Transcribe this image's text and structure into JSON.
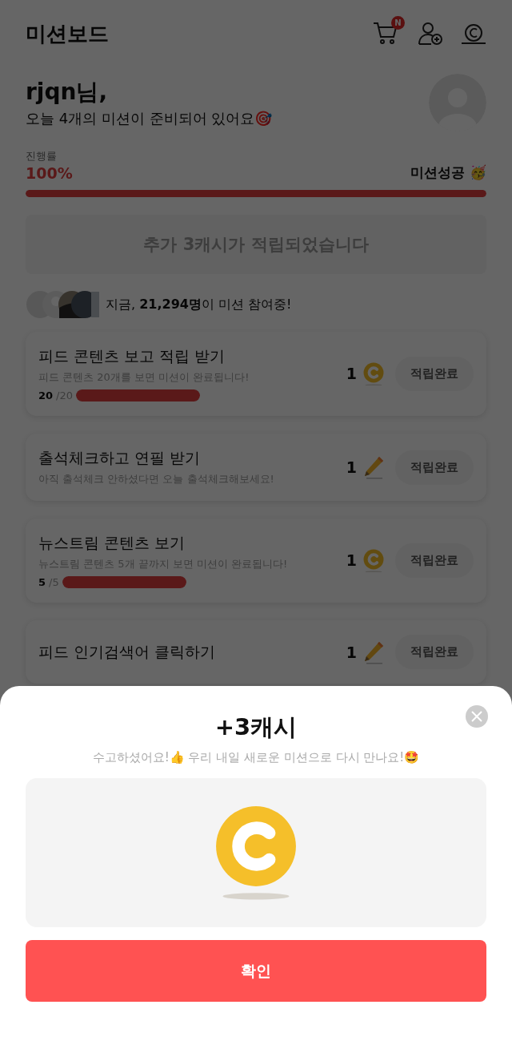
{
  "header": {
    "title": "미션보드",
    "cart_badge": "N"
  },
  "greeting": {
    "name": "rjqn님,",
    "message": "오늘 4개의 미션이 준비되어 있어요🎯"
  },
  "progress": {
    "label": "진행률",
    "percent": "100%",
    "status": "미션성공 🥳",
    "level": 1
  },
  "banner": {
    "text": "추가 3캐시가 적립되었습니다"
  },
  "participants": {
    "text": "지금, **21,294명**이 미션 참여중!"
  },
  "missions": [
    {
      "title": "피드 콘텐츠 보고 적립 받기",
      "description": "피드 콘텐츠 20개를 보면 미션이 완료됩니다!",
      "done": "20",
      "total": "/20",
      "level": 1,
      "reward": {
        "amount": "1",
        "kind": "coin"
      },
      "button": "적립완료",
      "disabled": true
    },
    {
      "title": "출석체크하고 연필 받기",
      "description": "아직 출석체크 안하셨다면 오늘 출석체크해보세요!",
      "reward": {
        "amount": "1",
        "kind": "pencil"
      },
      "button": "적립완료",
      "disabled": true
    },
    {
      "title": "뉴스트림 콘텐츠 보기",
      "description": "뉴스트림 콘텐츠 5개 끝까지 보면 미션이 완료됩니다!",
      "done": "5",
      "total": "/5",
      "level": 1,
      "reward": {
        "amount": "1",
        "kind": "coin"
      },
      "button": "적립완료",
      "disabled": true
    },
    {
      "title": "피드 인기검색어 클릭하기",
      "reward": {
        "amount": "1",
        "kind": "pencil"
      },
      "button": "적립완료",
      "disabled": true
    }
  ],
  "sheet": {
    "title": "+3캐시",
    "message": "수고하셨어요!👍 우리 내일 새로운 미션으로 다시 만나요!🤩",
    "confirm": "확인"
  }
}
